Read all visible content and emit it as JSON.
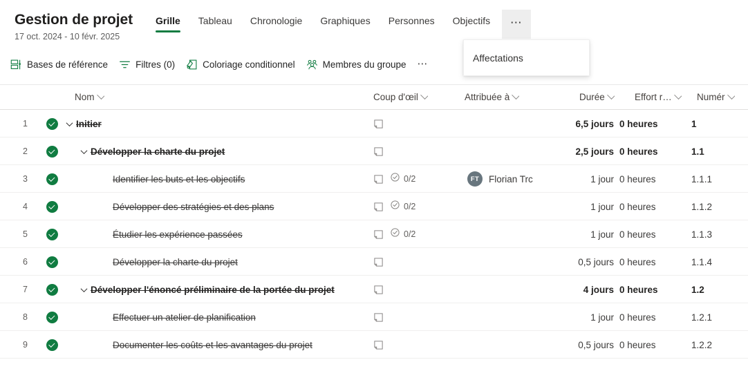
{
  "header": {
    "title": "Gestion de projet",
    "subtitle": "17 oct. 2024 - 10 févr. 2025",
    "tabs": [
      {
        "label": "Grille",
        "active": true
      },
      {
        "label": "Tableau",
        "active": false
      },
      {
        "label": "Chronologie",
        "active": false
      },
      {
        "label": "Graphiques",
        "active": false
      },
      {
        "label": "Personnes",
        "active": false
      },
      {
        "label": "Objectifs",
        "active": false
      }
    ],
    "more_tabs_icon": "ellipsis-icon",
    "accent_color": "#107c41"
  },
  "dropdown": {
    "open": true,
    "items": [
      {
        "label": "Affectations"
      }
    ]
  },
  "toolbar": {
    "items": [
      {
        "label": "Bases de référence",
        "icon": "baseline-icon"
      },
      {
        "label": "Filtres (0)",
        "icon": "filter-icon"
      },
      {
        "label": "Coloriage conditionnel",
        "icon": "conditional-formatting-icon"
      },
      {
        "label": "Membres du groupe",
        "icon": "group-members-icon"
      }
    ],
    "overflow_icon": "ellipsis-icon"
  },
  "grid": {
    "columns": [
      {
        "key": "name",
        "label": "Nom"
      },
      {
        "key": "glance",
        "label": "Coup d'œil"
      },
      {
        "key": "assigned",
        "label": "Attribuée à"
      },
      {
        "key": "duration",
        "label": "Durée"
      },
      {
        "key": "effort",
        "label": "Effort r…"
      },
      {
        "key": "wbs",
        "label": "Numér"
      }
    ],
    "rows": [
      {
        "num": "1",
        "status": "complete",
        "level": 1,
        "expandable": true,
        "name": "Initier",
        "summary": true,
        "note": true,
        "progress": "",
        "assignee": "",
        "initials": "",
        "duration": "6,5 jours",
        "effort": "0 heures",
        "wbs": "1"
      },
      {
        "num": "2",
        "status": "complete",
        "level": 2,
        "expandable": true,
        "name": "Développer la charte du projet",
        "summary": true,
        "note": true,
        "progress": "",
        "assignee": "",
        "initials": "",
        "duration": "2,5 jours",
        "effort": "0 heures",
        "wbs": "1.1"
      },
      {
        "num": "3",
        "status": "complete",
        "level": 3,
        "expandable": false,
        "name": "Identifier les buts et les objectifs",
        "summary": false,
        "note": true,
        "progress": "0/2",
        "assignee": "Florian Trc",
        "initials": "FT",
        "duration": "1 jour",
        "effort": "0 heures",
        "wbs": "1.1.1"
      },
      {
        "num": "4",
        "status": "complete",
        "level": 3,
        "expandable": false,
        "name": "Développer des stratégies et des plans",
        "summary": false,
        "note": true,
        "progress": "0/2",
        "assignee": "",
        "initials": "",
        "duration": "1 jour",
        "effort": "0 heures",
        "wbs": "1.1.2"
      },
      {
        "num": "5",
        "status": "complete",
        "level": 3,
        "expandable": false,
        "name": "Étudier les expérience passées",
        "summary": false,
        "note": true,
        "progress": "0/2",
        "assignee": "",
        "initials": "",
        "duration": "1 jour",
        "effort": "0 heures",
        "wbs": "1.1.3"
      },
      {
        "num": "6",
        "status": "complete",
        "level": 3,
        "expandable": false,
        "name": "Développer la charte du projet",
        "summary": false,
        "note": true,
        "progress": "",
        "assignee": "",
        "initials": "",
        "duration": "0,5 jours",
        "effort": "0 heures",
        "wbs": "1.1.4"
      },
      {
        "num": "7",
        "status": "complete",
        "level": 2,
        "expandable": true,
        "name": "Développer l'énoncé préliminaire de la portée du projet",
        "summary": true,
        "note": true,
        "progress": "",
        "assignee": "",
        "initials": "",
        "duration": "4 jours",
        "effort": "0 heures",
        "wbs": "1.2"
      },
      {
        "num": "8",
        "status": "complete",
        "level": 3,
        "expandable": false,
        "name": "Effectuer un atelier de planification",
        "summary": false,
        "note": true,
        "progress": "",
        "assignee": "",
        "initials": "",
        "duration": "1 jour",
        "effort": "0 heures",
        "wbs": "1.2.1"
      },
      {
        "num": "9",
        "status": "complete",
        "level": 3,
        "expandable": false,
        "name": "Documenter les coûts et les avantages du projet",
        "summary": false,
        "note": true,
        "progress": "",
        "assignee": "",
        "initials": "",
        "duration": "0,5 jours",
        "effort": "0 heures",
        "wbs": "1.2.2"
      }
    ]
  }
}
